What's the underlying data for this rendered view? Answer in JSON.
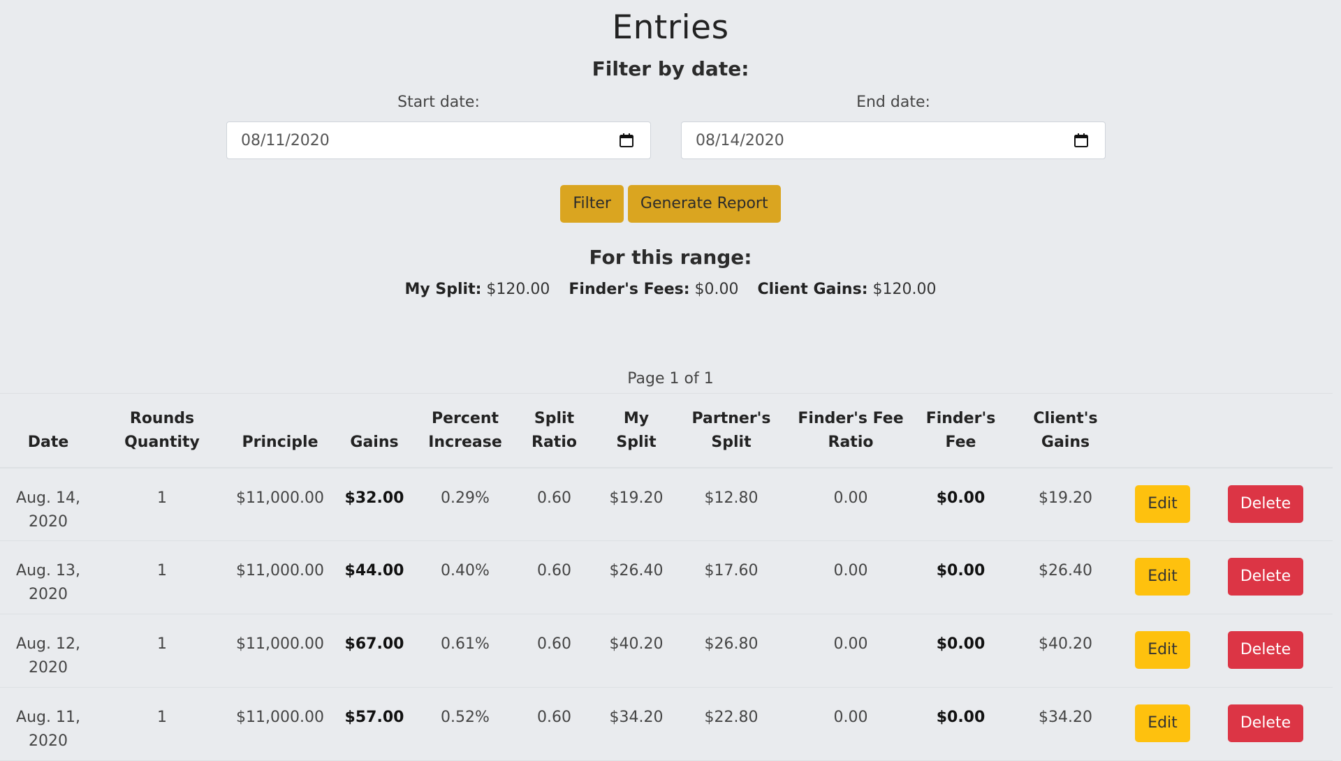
{
  "page": {
    "title": "Entries",
    "filter_heading": "Filter by date:"
  },
  "filter": {
    "start_label": "Start date:",
    "start_value": "08/11/2020",
    "end_label": "End date:",
    "end_value": "08/14/2020",
    "filter_button": "Filter",
    "report_button": "Generate Report"
  },
  "range": {
    "heading": "For this range:",
    "my_split_label": "My Split:",
    "my_split_value": "$120.00",
    "finders_fees_label": "Finder's Fees:",
    "finders_fees_value": "$0.00",
    "client_gains_label": "Client Gains:",
    "client_gains_value": "$120.00"
  },
  "pagination": {
    "text": "Page 1 of 1"
  },
  "table": {
    "headers": {
      "date": "Date",
      "rounds_line1": "Rounds",
      "rounds_line2": "Quantity",
      "principle": "Principle",
      "gains": "Gains",
      "percent_line1": "Percent",
      "percent_line2": "Increase",
      "split_line1": "Split",
      "split_line2": "Ratio",
      "mysplit_line1": "My",
      "mysplit_line2": "Split",
      "partner_line1": "Partner's",
      "partner_line2": "Split",
      "ffratio_line1": "Finder's Fee",
      "ffratio_line2": "Ratio",
      "ffee_line1": "Finder's",
      "ffee_line2": "Fee",
      "client_line1": "Client's",
      "client_line2": "Gains"
    },
    "edit_label": "Edit",
    "delete_label": "Delete",
    "rows": [
      {
        "date_line1": "Aug. 14,",
        "date_line2": "2020",
        "rounds": "1",
        "principle": "$11,000.00",
        "gains": "$32.00",
        "percent": "0.29%",
        "split_ratio": "0.60",
        "my_split": "$19.20",
        "partner_split": "$12.80",
        "ff_ratio": "0.00",
        "ff_fee": "$0.00",
        "client_gains": "$19.20"
      },
      {
        "date_line1": "Aug. 13,",
        "date_line2": "2020",
        "rounds": "1",
        "principle": "$11,000.00",
        "gains": "$44.00",
        "percent": "0.40%",
        "split_ratio": "0.60",
        "my_split": "$26.40",
        "partner_split": "$17.60",
        "ff_ratio": "0.00",
        "ff_fee": "$0.00",
        "client_gains": "$26.40"
      },
      {
        "date_line1": "Aug. 12,",
        "date_line2": "2020",
        "rounds": "1",
        "principle": "$11,000.00",
        "gains": "$67.00",
        "percent": "0.61%",
        "split_ratio": "0.60",
        "my_split": "$40.20",
        "partner_split": "$26.80",
        "ff_ratio": "0.00",
        "ff_fee": "$0.00",
        "client_gains": "$40.20"
      },
      {
        "date_line1": "Aug. 11,",
        "date_line2": "2020",
        "rounds": "1",
        "principle": "$11,000.00",
        "gains": "$57.00",
        "percent": "0.52%",
        "split_ratio": "0.60",
        "my_split": "$34.20",
        "partner_split": "$22.80",
        "ff_ratio": "0.00",
        "ff_fee": "$0.00",
        "client_gains": "$34.20"
      }
    ]
  },
  "icons": {
    "calendar": "calendar-icon"
  },
  "colors": {
    "background": "#e9ebee",
    "gold_button": "#daa520",
    "edit_button": "#fec10e",
    "delete_button": "#dc3545"
  }
}
